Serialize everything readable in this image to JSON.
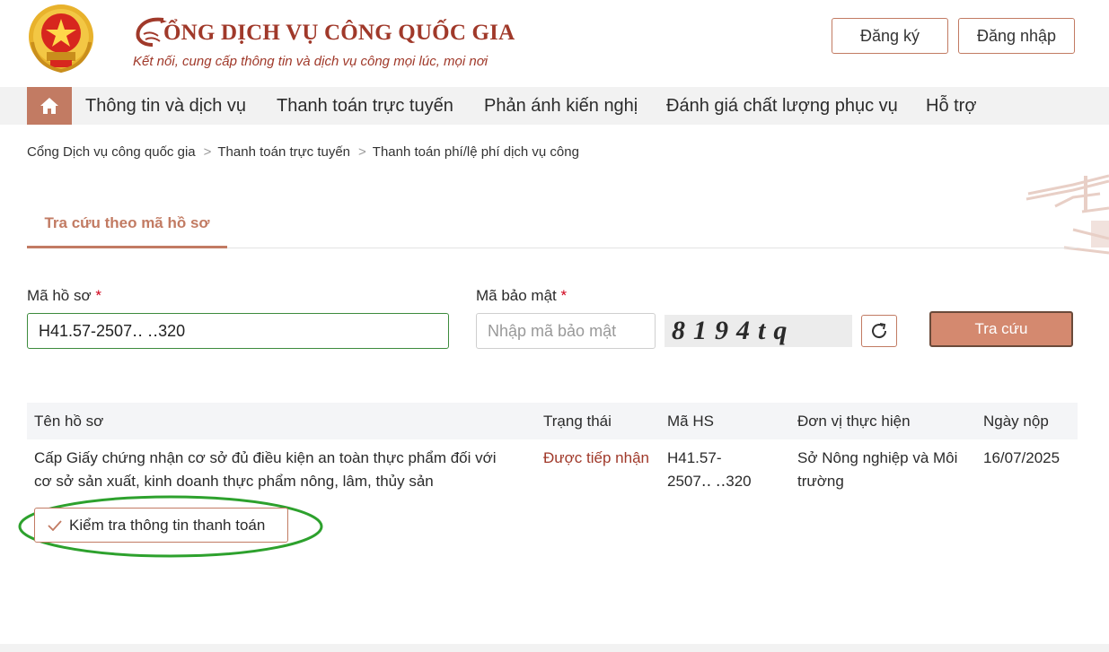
{
  "header": {
    "title": "CỔNG DỊCH VỤ CÔNG QUỐC GIA",
    "title_rest": "ỔNG DỊCH VỤ CÔNG QUỐC GIA",
    "subtitle": "Kết nối, cung cấp thông tin và dịch vụ công mọi lúc, mọi nơi",
    "register_label": "Đăng ký",
    "login_label": "Đăng nhập",
    "emblem_icon": "national-emblem-icon"
  },
  "nav": {
    "home_icon": "home-icon",
    "items": [
      {
        "label": "Thông tin và dịch vụ"
      },
      {
        "label": "Thanh toán trực tuyến"
      },
      {
        "label": "Phản ánh kiến nghị"
      },
      {
        "label": "Đánh giá chất lượng phục vụ"
      },
      {
        "label": "Hỗ trợ"
      }
    ]
  },
  "breadcrumb": {
    "items": [
      "Cổng Dịch vụ công quốc gia",
      "Thanh toán trực tuyến",
      "Thanh toán phí/lệ phí dịch vụ công"
    ],
    "separator": ">"
  },
  "tabs": {
    "active_label": "Tra cứu theo mã hồ sơ"
  },
  "form": {
    "hoso_label": "Mã hồ sơ",
    "hoso_value": "H41.57-2507‥ ‥320",
    "security_label": "Mã bảo mật",
    "required_mark": "*",
    "security_placeholder": "Nhập mã bảo mật",
    "captcha_text": "8194tq",
    "search_label": "Tra cứu",
    "refresh_icon": "refresh-icon"
  },
  "table": {
    "headers": [
      "Tên hồ sơ",
      "Trạng thái",
      "Mã HS",
      "Đơn vị thực hiện",
      "Ngày nộp"
    ],
    "rows": [
      {
        "name_line1": "Cấp Giấy chứng nhận cơ sở đủ điều kiện an toàn thực phẩm đối với",
        "name_line2": "cơ sở sản xuất, kinh doanh thực phẩm nông, lâm, thủy sản",
        "status": "Được tiếp nhận",
        "code_line1": "H41.57-",
        "code_line2": "2507‥ ‥320",
        "unit_line1": "Sở Nông nghiệp và Môi",
        "unit_line2": "trường",
        "date": "16/07/2025"
      }
    ],
    "check_payment_label": "Kiểm tra thông tin thanh toán"
  },
  "colors": {
    "brand": "#a0392a",
    "accent": "#c27b63",
    "highlight_ring": "#2da12d"
  }
}
